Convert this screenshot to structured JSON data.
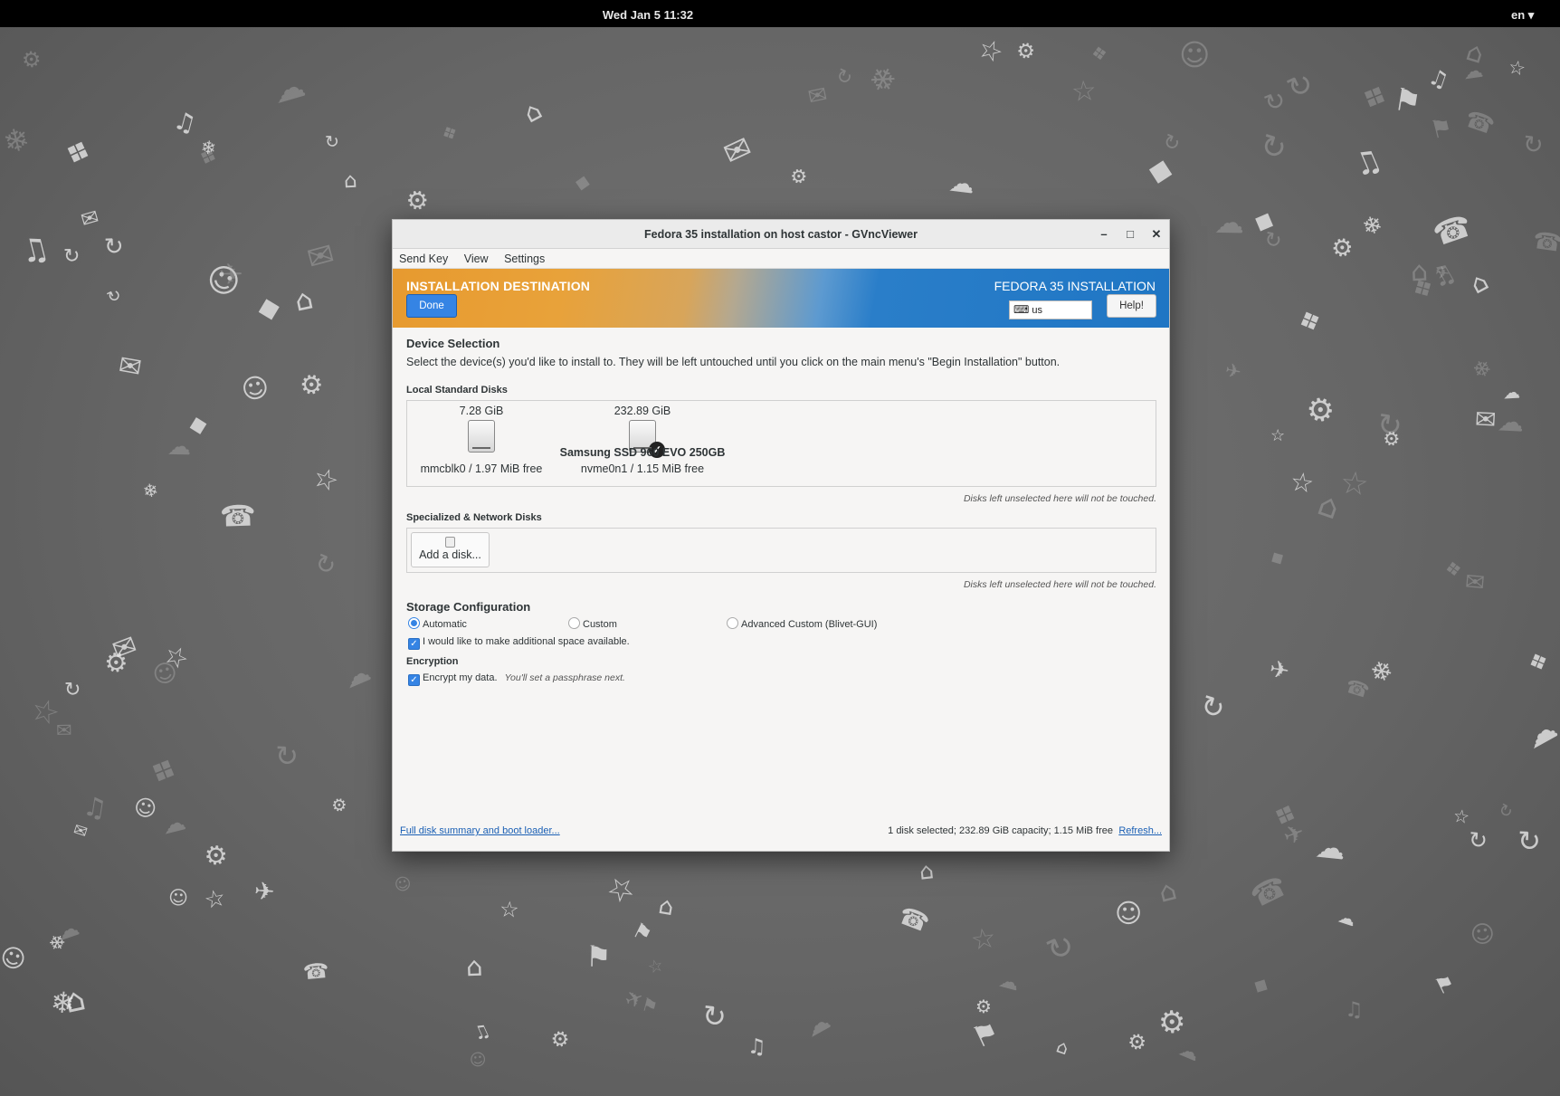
{
  "topbar": {
    "clock": "Wed Jan 5  11:32",
    "language": "en ▾"
  },
  "window": {
    "title": "Fedora 35 installation on host castor - GVncViewer",
    "controls": {
      "minimize": "–",
      "maximize": "□",
      "close": "✕"
    }
  },
  "menu": {
    "items": [
      "Send Key",
      "View",
      "Settings"
    ]
  },
  "header": {
    "title": "INSTALLATION DESTINATION",
    "done_label": "Done",
    "product": "FEDORA 35 INSTALLATION",
    "keyboard_icon": "⌨",
    "keyboard_layout": "us",
    "help_label": "Help!"
  },
  "device_selection": {
    "title": "Device Selection",
    "description": "Select the device(s) you'd like to install to.  They will be left untouched until you click on the main menu's \"Begin Installation\" button."
  },
  "local_disks": {
    "title": "Local Standard Disks",
    "disks": [
      {
        "size": "7.28 GiB",
        "name": "",
        "info": "mmcblk0  /  1.97 MiB free",
        "selected": false
      },
      {
        "size": "232.89 GiB",
        "name": "Samsung SSD 960 EVO 250GB",
        "info": "nvme0n1   /   1.15 MiB free",
        "selected": true
      }
    ],
    "note": "Disks left unselected here will not be touched."
  },
  "network_disks": {
    "title": "Specialized & Network Disks",
    "add_label": "Add a disk...",
    "note": "Disks left unselected here will not be touched."
  },
  "storage_config": {
    "title": "Storage Configuration",
    "options": [
      {
        "label": "Automatic",
        "selected": true
      },
      {
        "label": "Custom",
        "selected": false
      },
      {
        "label": "Advanced Custom (Blivet-GUI)",
        "selected": false
      }
    ],
    "reclaim_label": "I would like to make additional space available.",
    "reclaim_checked": true
  },
  "encryption": {
    "title": "Encryption",
    "label": "Encrypt my data.",
    "hint": "You'll set a passphrase next.",
    "checked": true
  },
  "footer": {
    "summary_link": "Full disk summary and boot loader...",
    "status": "1 disk selected; 232.89 GiB capacity; 1.15 MiB free",
    "refresh_link": "Refresh..."
  }
}
